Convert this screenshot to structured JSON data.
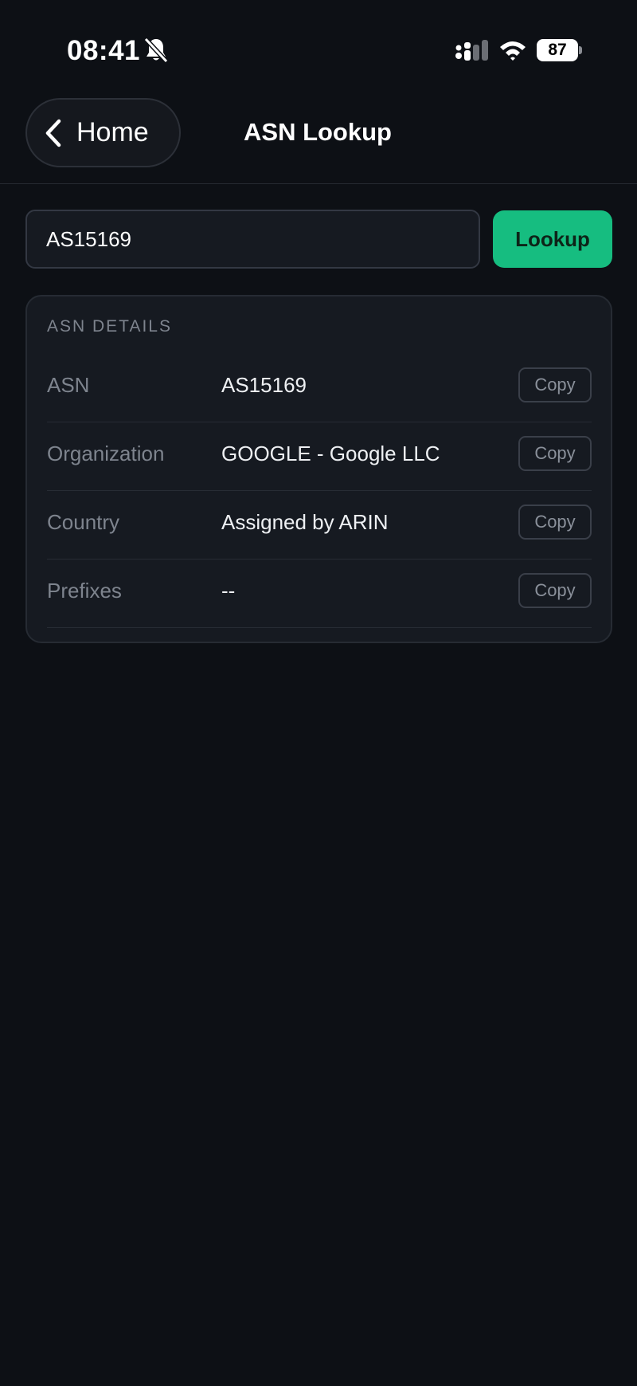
{
  "status_bar": {
    "time": "08:41",
    "battery": "87",
    "icons": [
      "bell-slash-icon",
      "cellular-signal-icon",
      "wifi-icon",
      "battery-icon"
    ]
  },
  "nav": {
    "back_label": "Home",
    "back_icon": "chevron-left-icon",
    "title": "ASN Lookup"
  },
  "search": {
    "value": "AS15169",
    "button_label": "Lookup"
  },
  "details": {
    "heading": "ASN DETAILS",
    "rows": [
      {
        "label": "ASN",
        "value": "AS15169",
        "action": "Copy"
      },
      {
        "label": "Organization",
        "value": "GOOGLE - Google LLC",
        "action": "Copy"
      },
      {
        "label": "Country",
        "value": "Assigned by ARIN",
        "action": "Copy"
      },
      {
        "label": "Prefixes",
        "value": "--",
        "action": "Copy"
      }
    ]
  },
  "colors": {
    "background": "#0d1015",
    "card": "#161a21",
    "accent": "#16bd80"
  }
}
